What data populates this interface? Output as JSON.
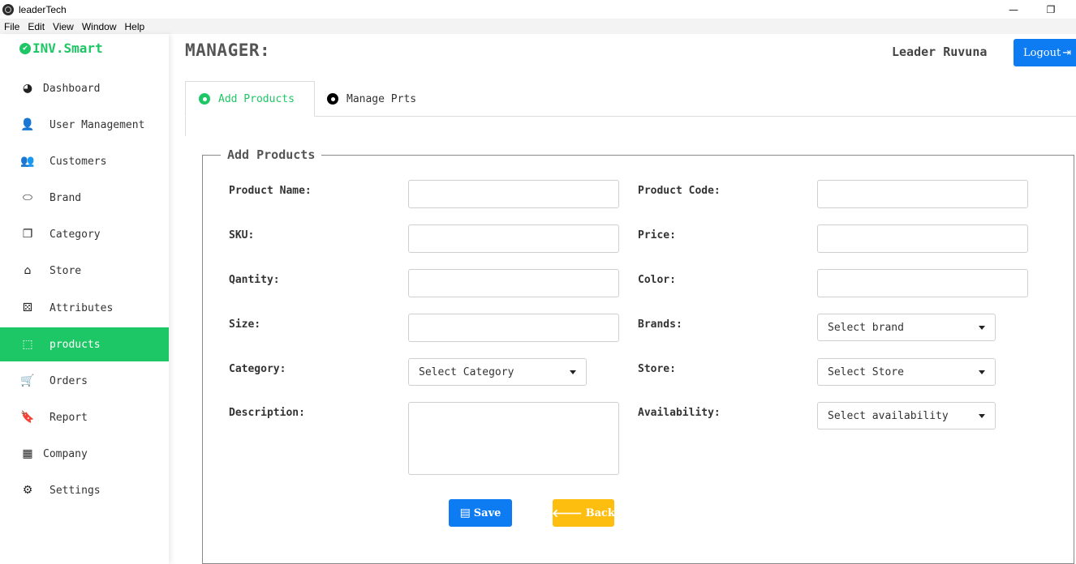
{
  "window": {
    "title": "leaderTech",
    "minimize": "—",
    "restore": "❐"
  },
  "menubar": {
    "items": [
      "File",
      "Edit",
      "View",
      "Window",
      "Help"
    ]
  },
  "brand": {
    "name": "INV.Smart",
    "color": "#1ec765"
  },
  "sidebar": {
    "items": [
      {
        "label": "Dashboard",
        "icon": "dashboard-icon",
        "glyph": "◕",
        "active": false
      },
      {
        "label": "User Management",
        "icon": "user-icon",
        "glyph": "👤",
        "active": false
      },
      {
        "label": "Customers",
        "icon": "users-icon",
        "glyph": "👥",
        "active": false
      },
      {
        "label": "Brand",
        "icon": "ring-icon",
        "glyph": "⬭",
        "active": false
      },
      {
        "label": "Category",
        "icon": "copy-icon",
        "glyph": "❐",
        "active": false
      },
      {
        "label": "Store",
        "icon": "store-icon",
        "glyph": "⌂",
        "active": false
      },
      {
        "label": "Attributes",
        "icon": "dice-icon",
        "glyph": "⚄",
        "active": false
      },
      {
        "label": "products",
        "icon": "box-icon",
        "glyph": "⬚",
        "active": true
      },
      {
        "label": "Orders",
        "icon": "cart-icon",
        "glyph": "🛒",
        "active": false
      },
      {
        "label": "Report",
        "icon": "bookmark-icon",
        "glyph": "🔖",
        "active": false
      },
      {
        "label": "Company",
        "icon": "building-icon",
        "glyph": "▦",
        "active": false
      },
      {
        "label": "Settings",
        "icon": "gear-icon",
        "glyph": "⚙",
        "active": false
      }
    ]
  },
  "header": {
    "title": "MANAGER:",
    "user": "Leader Ruvuna",
    "logout_label": "Logout"
  },
  "tabs": [
    {
      "label": "Add Products",
      "active": true
    },
    {
      "label": "Manage Prts",
      "active": false
    }
  ],
  "form": {
    "legend": "Add Products",
    "labels": {
      "product_name": "Product Name:",
      "product_code": "Product Code:",
      "sku": "SKU:",
      "price": "Price:",
      "quantity": "Qantity:",
      "color": "Color:",
      "size": "Size:",
      "brands": "Brands:",
      "category": "Category:",
      "store": "Store:",
      "description": "Description:",
      "availability": "Availability:"
    },
    "selects": {
      "brand": "Select brand",
      "category": "Select Category",
      "store": "Select Store",
      "availability": "Select availability"
    },
    "buttons": {
      "save": "Save",
      "back": "Back"
    }
  },
  "colors": {
    "accent_green": "#1ec765",
    "primary_blue": "#0d7cf2",
    "warning_yellow": "#fdbe10"
  }
}
